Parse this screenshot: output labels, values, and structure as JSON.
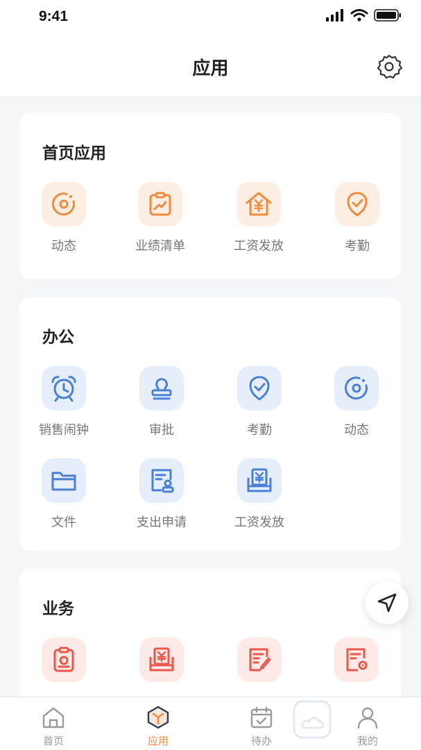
{
  "status": {
    "time": "9:41"
  },
  "header": {
    "title": "应用"
  },
  "sections": [
    {
      "title": "首页应用",
      "items": [
        {
          "label": "动态",
          "icon": "dynamic-icon"
        },
        {
          "label": "业绩清单",
          "icon": "performance-list-icon"
        },
        {
          "label": "工资发放",
          "icon": "salary-house-icon"
        },
        {
          "label": "考勤",
          "icon": "attendance-shield-icon"
        }
      ]
    },
    {
      "title": "办公",
      "items": [
        {
          "label": "销售闹钟",
          "icon": "alarm-clock-icon"
        },
        {
          "label": "审批",
          "icon": "stamp-icon"
        },
        {
          "label": "考勤",
          "icon": "attendance-shield-icon"
        },
        {
          "label": "动态",
          "icon": "dynamic-icon"
        },
        {
          "label": "文件",
          "icon": "folder-icon"
        },
        {
          "label": "支出申请",
          "icon": "expense-form-icon"
        },
        {
          "label": "工资发放",
          "icon": "salary-tray-icon"
        }
      ]
    },
    {
      "title": "业务",
      "items": [
        {
          "label": "",
          "icon": "clipboard-gear-icon"
        },
        {
          "label": "",
          "icon": "payment-tray-icon"
        },
        {
          "label": "",
          "icon": "edit-report-icon"
        },
        {
          "label": "",
          "icon": "settings-report-icon"
        }
      ]
    }
  ],
  "tabbar": {
    "items": [
      {
        "label": "首页",
        "icon": "home-icon"
      },
      {
        "label": "应用",
        "icon": "apps-icon",
        "active": true
      },
      {
        "label": "待办",
        "icon": "calendar-check-icon"
      },
      {
        "label": "我的",
        "icon": "user-icon"
      }
    ]
  },
  "colors": {
    "orange": "#f08a3c",
    "blue": "#4a7fd6",
    "red": "#e8584a",
    "card": "#ffffff",
    "page": "#f5f6f8"
  }
}
